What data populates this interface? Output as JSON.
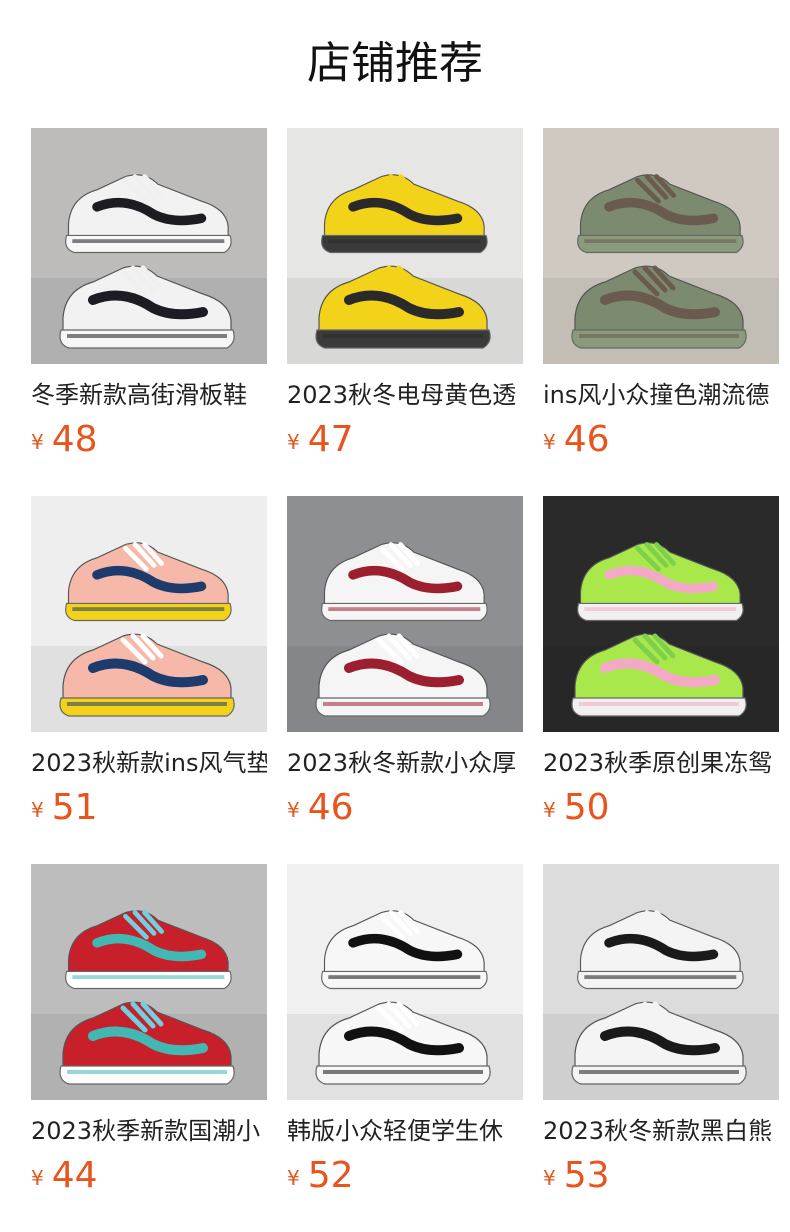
{
  "header": {
    "title": "店铺推荐"
  },
  "products": [
    {
      "name": "冬季新款高街滑板鞋",
      "currency": "¥",
      "price": "48",
      "image_icon": "black-white-sneaker-image",
      "colors": {
        "bg": "#bdbcbb",
        "upper": "#f2f2f2",
        "accent": "#1c1c22",
        "sole": "#f7f7f7",
        "lace": "#f0f0f0"
      }
    },
    {
      "name": "2023秋冬电母黄色透",
      "currency": "¥",
      "price": "47",
      "image_icon": "yellow-sneaker-image",
      "colors": {
        "bg": "#e6e6e4",
        "upper": "#f3d21a",
        "accent": "#2a2a2a",
        "sole": "#3a3a3a",
        "lace": "#f3d21a"
      }
    },
    {
      "name": "ins风小众撞色潮流德",
      "currency": "¥",
      "price": "46",
      "image_icon": "olive-sneaker-image",
      "colors": {
        "bg": "#cfc9c1",
        "upper": "#7c8a70",
        "accent": "#6b5a4e",
        "sole": "#8a9b7c",
        "lace": "#6b5a4e"
      }
    },
    {
      "name": "2023秋新款ins风气垫",
      "currency": "¥",
      "price": "51",
      "image_icon": "pink-yellow-sneaker-image",
      "colors": {
        "bg": "#eeeeee",
        "upper": "#f6b8a8",
        "accent": "#1d3b6d",
        "sole": "#f3d21a",
        "lace": "#ffffff"
      }
    },
    {
      "name": "2023秋冬新款小众厚",
      "currency": "¥",
      "price": "46",
      "image_icon": "white-red-sneaker-image",
      "colors": {
        "bg": "#8d8f93",
        "upper": "#f5f5f5",
        "accent": "#9b1f2e",
        "sole": "#f5f5f5",
        "lace": "#ffffff"
      }
    },
    {
      "name": "2023秋季原创果冻鸳",
      "currency": "¥",
      "price": "50",
      "image_icon": "green-pink-sneaker-image",
      "colors": {
        "bg": "#2a2a2a",
        "upper": "#a8e84a",
        "accent": "#f3a9c6",
        "sole": "#f0f0f0",
        "lace": "#7ed04a"
      }
    },
    {
      "name": "2023秋季新款国潮小",
      "currency": "¥",
      "price": "44",
      "image_icon": "red-teal-sneaker-image",
      "colors": {
        "bg": "#bdbdbd",
        "upper": "#c8202a",
        "accent": "#41b8b4",
        "sole": "#ffffff",
        "lace": "#6fd0e0"
      }
    },
    {
      "name": "韩版小众轻便学生休",
      "currency": "¥",
      "price": "52",
      "image_icon": "white-black-lace-sneaker-image",
      "colors": {
        "bg": "#f0f0f0",
        "upper": "#f7f7f7",
        "accent": "#111111",
        "sole": "#f7f7f7",
        "lace": "#ffffff"
      }
    },
    {
      "name": "2023秋冬新款黑白熊",
      "currency": "¥",
      "price": "53",
      "image_icon": "graffiti-sneaker-image",
      "colors": {
        "bg": "#dcdcdc",
        "upper": "#f4f4f4",
        "accent": "#1a1a1a",
        "sole": "#f4f4f4",
        "lace": "#f4f4f4"
      }
    }
  ]
}
